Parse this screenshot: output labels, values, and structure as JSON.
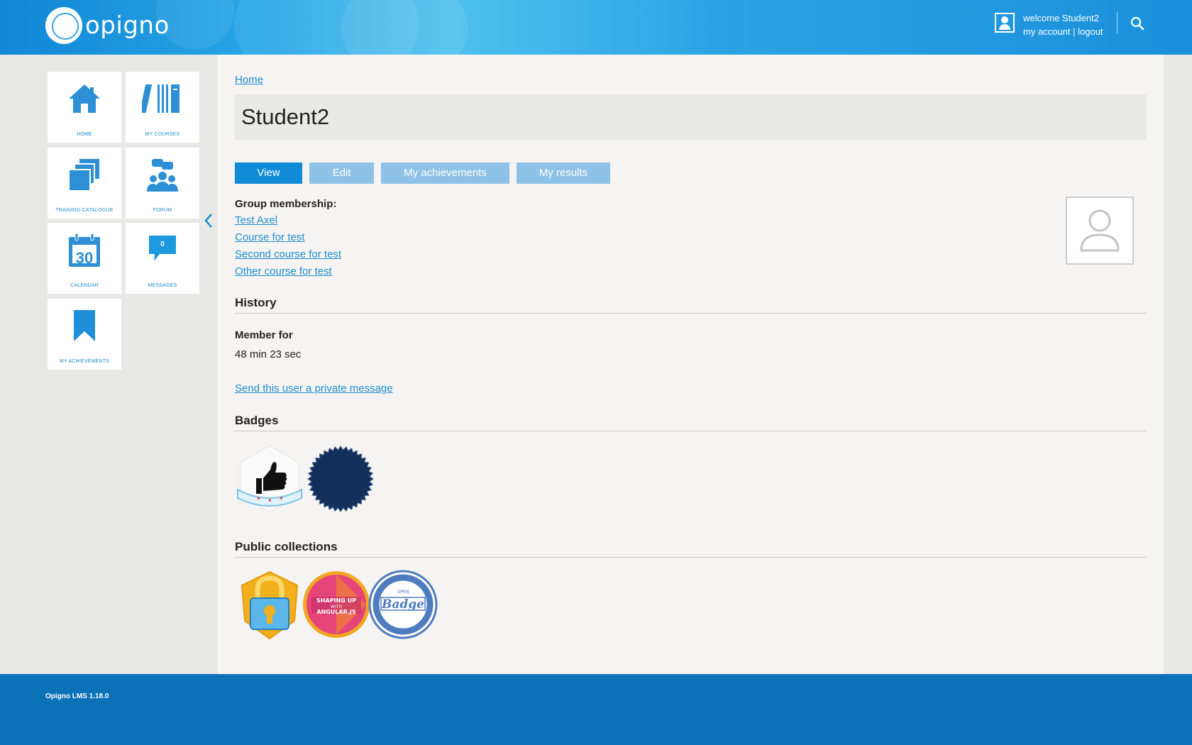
{
  "header": {
    "logo_text": "opigno",
    "welcome": "welcome Student2",
    "my_account": "my account",
    "separator": "|",
    "logout": "logout",
    "search_icon": "search-icon"
  },
  "sidebar": {
    "tiles": [
      {
        "label": "HOME",
        "icon": "home-icon"
      },
      {
        "label": "MY COURSES",
        "icon": "books-icon"
      },
      {
        "label": "TRAINING CATALOGUE",
        "icon": "catalogue-icon"
      },
      {
        "label": "FORUM",
        "icon": "forum-icon"
      },
      {
        "label": "CALENDAR",
        "icon": "calendar-icon",
        "day": "30"
      },
      {
        "label": "MESSAGES",
        "icon": "messages-icon",
        "count": "0"
      },
      {
        "label": "MY ACHIEVEMENTS",
        "icon": "bookmark-icon"
      }
    ],
    "collapse_icon": "chevron-left-icon"
  },
  "main": {
    "breadcrumb": "Home",
    "title": "Student2",
    "tabs": [
      {
        "label": "View",
        "active": true
      },
      {
        "label": "Edit",
        "active": false
      },
      {
        "label": "My achievements",
        "active": false
      },
      {
        "label": "My results",
        "active": false
      }
    ],
    "group_membership_label": "Group membership:",
    "groups": [
      "Test Axel",
      "Course for test",
      "Second course for test",
      "Other course for test"
    ],
    "history_title": "History",
    "member_for_label": "Member for",
    "member_for_value": "48 min 23 sec",
    "private_message_link": "Send this user a private message",
    "badges_title": "Badges",
    "badges": [
      "thumbs-up-badge",
      "navy-seal-badge"
    ],
    "public_collections_title": "Public collections",
    "collections": [
      "lock-badge",
      "angular-badge",
      "open-badge"
    ],
    "collection_texts": {
      "angular_line1": "SHAPING UP",
      "angular_line2": "WITH",
      "angular_line3": "ANGULAR.JS",
      "open_small": "OPEN",
      "open_word": "Badge"
    }
  },
  "footer": {
    "version": "Opigno LMS 1.18.0"
  },
  "colors": {
    "accent": "#0f8bd8",
    "tab_inactive": "#8ec2e6",
    "footer": "#0b72b8",
    "link": "#1f8ccc"
  }
}
